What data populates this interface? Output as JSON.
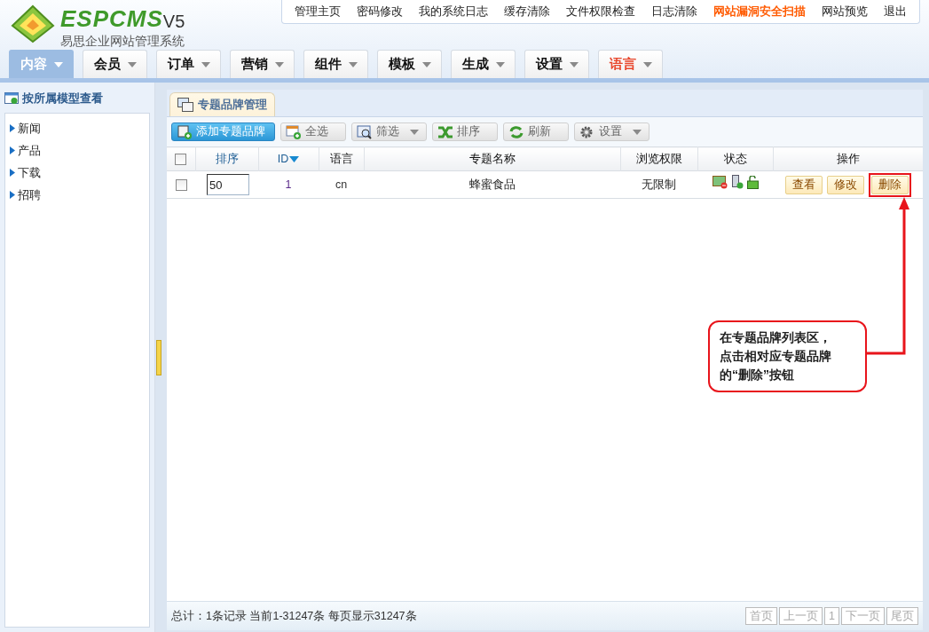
{
  "logo": {
    "brand": "ESPCMS",
    "version": "V5",
    "subtitle": "易思企业网站管理系统"
  },
  "top_links": [
    {
      "label": "管理主页",
      "highlight": false
    },
    {
      "label": "密码修改",
      "highlight": false
    },
    {
      "label": "我的系统日志",
      "highlight": false
    },
    {
      "label": "缓存清除",
      "highlight": false
    },
    {
      "label": "文件权限检查",
      "highlight": false
    },
    {
      "label": "日志清除",
      "highlight": false
    },
    {
      "label": "网站漏洞安全扫描",
      "highlight": true
    },
    {
      "label": "网站预览",
      "highlight": false
    },
    {
      "label": "退出",
      "highlight": false
    }
  ],
  "nav_tabs": [
    {
      "label": "内容",
      "selected": true,
      "highlight": false
    },
    {
      "label": "会员",
      "selected": false,
      "highlight": false
    },
    {
      "label": "订单",
      "selected": false,
      "highlight": false
    },
    {
      "label": "营销",
      "selected": false,
      "highlight": false
    },
    {
      "label": "组件",
      "selected": false,
      "highlight": false
    },
    {
      "label": "模板",
      "selected": false,
      "highlight": false
    },
    {
      "label": "生成",
      "selected": false,
      "highlight": false
    },
    {
      "label": "设置",
      "selected": false,
      "highlight": false
    },
    {
      "label": "语言",
      "selected": false,
      "highlight": true
    }
  ],
  "sidebar": {
    "title": "按所属模型查看",
    "items": [
      {
        "label": "新闻"
      },
      {
        "label": "产品"
      },
      {
        "label": "下载"
      },
      {
        "label": "招聘"
      }
    ]
  },
  "panel_tab": {
    "label": "专题品牌管理"
  },
  "toolbar": [
    {
      "label": "添加专题品牌",
      "kind": "primary",
      "dropdown": false
    },
    {
      "label": "全选",
      "kind": "normal",
      "dropdown": false
    },
    {
      "label": "筛选",
      "kind": "normal",
      "dropdown": true
    },
    {
      "label": "排序",
      "kind": "normal",
      "dropdown": false
    },
    {
      "label": "刷新",
      "kind": "normal",
      "dropdown": false
    },
    {
      "label": "设置",
      "kind": "normal",
      "dropdown": true
    }
  ],
  "table": {
    "all_checked": false,
    "columns": [
      {
        "label": "排序",
        "sortable": true,
        "sorted": false
      },
      {
        "label": "ID",
        "sortable": true,
        "sorted": true
      },
      {
        "label": "语言",
        "sortable": false,
        "sorted": false
      },
      {
        "label": "专题名称",
        "sortable": false,
        "sorted": false
      },
      {
        "label": "浏览权限",
        "sortable": false,
        "sorted": false
      },
      {
        "label": "状态",
        "sortable": false,
        "sorted": false
      },
      {
        "label": "操作",
        "sortable": false,
        "sorted": false
      }
    ],
    "rows": [
      {
        "checked": false,
        "order": "50",
        "id": "1",
        "lang": "cn",
        "name": "蜂蜜食品",
        "access": "无限制",
        "actions": [
          {
            "label": "查看",
            "marked": false
          },
          {
            "label": "修改",
            "marked": false
          },
          {
            "label": "删除",
            "marked": true
          }
        ]
      }
    ]
  },
  "footer": {
    "summary": "总计：1条记录 当前1-31247条 每页显示31247条",
    "pager": [
      {
        "label": "首页"
      },
      {
        "label": "上一页"
      },
      {
        "label": "1"
      },
      {
        "label": "下一页"
      },
      {
        "label": "尾页"
      }
    ]
  },
  "callout": {
    "lines": [
      "在专题品牌列表区，",
      "点击相对应专题品牌",
      "的“删除”按钮"
    ]
  }
}
